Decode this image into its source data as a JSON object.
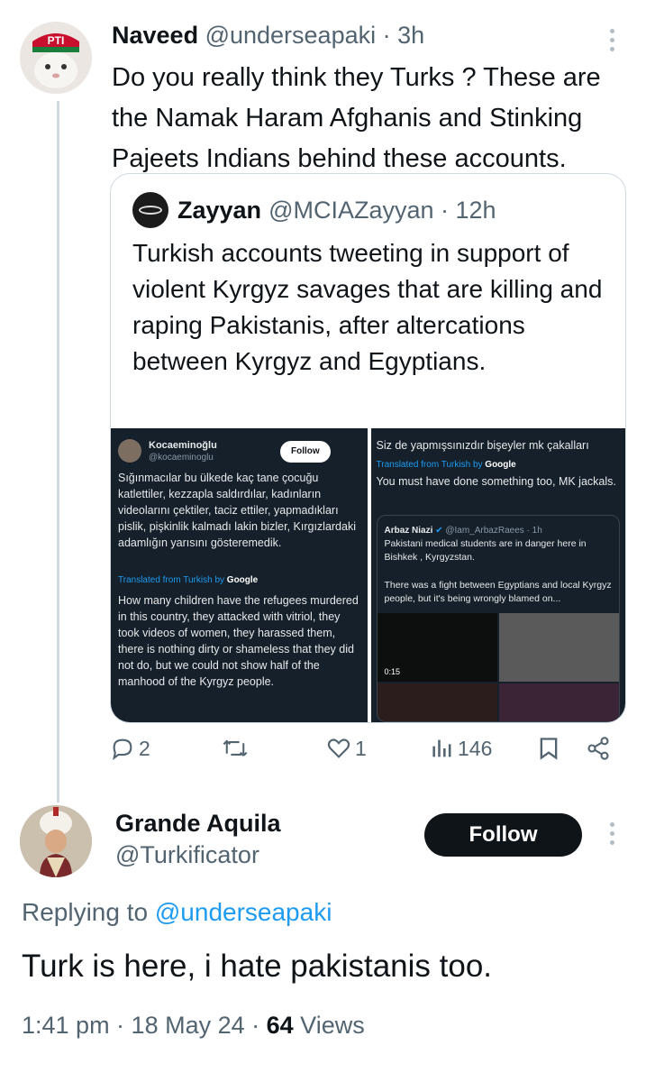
{
  "tweet": {
    "author_name": "Naveed",
    "meta": "@underseapaki · 3h",
    "avatar_badge": "PTI",
    "text": "Do you really think they Turks ? These are the Namak Haram Afghanis and Stinking Pajeets Indians behind these accounts.",
    "quote": {
      "author_name": "Zayyan",
      "meta": "@MCIAZayyan · 12h",
      "text": "Turkish accounts tweeting in support of violent Kyrgyz savages that are killing and raping Pakistanis, after altercations between Kyrgyz and Egyptians.",
      "left_shot": {
        "name": "Kocaeminoğlu",
        "handle": "@kocaeminoglu",
        "follow": "Follow",
        "original": "Sığınmacılar bu ülkede kaç tane çocuğu katlettiler, kezzapla saldırdılar, kadınların videolarını çektiler, taciz ettiler, yapmadıkları pislik, pişkinlik kalmadı lakin bizler, Kırgızlardaki adamlığın yarısını gösteremedik.",
        "translated_label": "Translated from Turkish by",
        "translated_by": "Google",
        "translation": "How many children have the refugees murdered in this country, they attacked with vitriol, they took videos of women, they harassed them, there is nothing dirty or shameless that they did not do, but we could not show half of the manhood of the Kyrgyz people."
      },
      "right_shot": {
        "original": "Siz de yapmışsınızdır bişeyler mk çakalları",
        "translated_label": "Translated from Turkish by",
        "translated_by": "Google",
        "translation": "You must have done something too, MK jackals.",
        "inner": {
          "name": "Arbaz Niazi",
          "verified": "✔",
          "meta": "@Iam_ArbazRaees · 1h",
          "line1": "Pakistani medical students are in danger here in Bishkek , Kyrgyzstan.",
          "line2": "There was a fight between Egyptians and local Kyrgyz people, but it's being wrongly blamed on...",
          "duration": "0:15"
        }
      }
    },
    "actions": {
      "replies": "2",
      "retweets": "",
      "likes": "1",
      "views": "146"
    }
  },
  "reply": {
    "author_name": "Grande Aquila",
    "handle": "@Turkificator",
    "follow_label": "Follow",
    "replying_prefix": "Replying to ",
    "replying_to": "@underseapaki",
    "text": "Turk is here, i hate pakistanis too.",
    "time": "1:41 pm · 18 May 24 · ",
    "views_count": "64",
    "views_label": " Views"
  },
  "colors": {
    "text": "#0f1419",
    "secondary": "#536471",
    "link": "#1d9bf0",
    "border": "#cfd9de",
    "dark_card": "#15202b"
  }
}
